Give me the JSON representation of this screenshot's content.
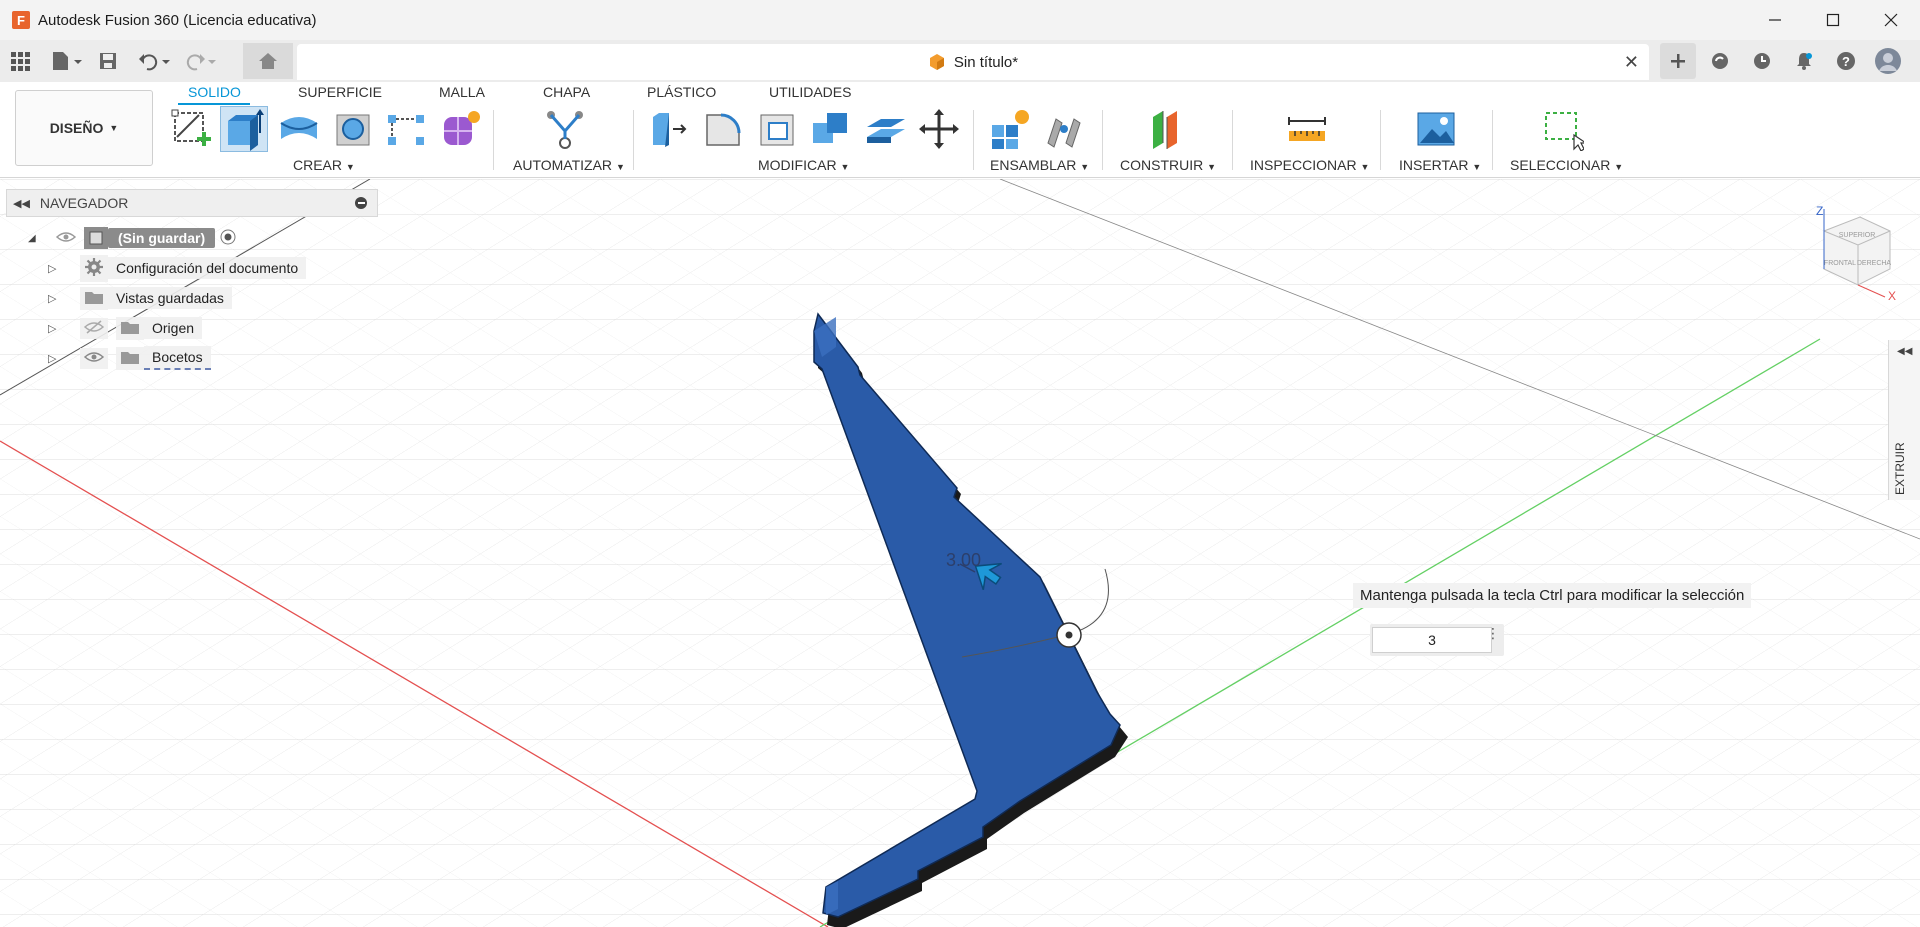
{
  "window": {
    "title": "Autodesk Fusion 360 (Licencia educativa)",
    "app_icon_letter": "F"
  },
  "document_tab": {
    "title": "Sin título*"
  },
  "ribbon": {
    "workspace_label": "DISEÑO",
    "tabs": [
      "SOLIDO",
      "SUPERFICIE",
      "MALLA",
      "CHAPA",
      "PLÁSTICO",
      "UTILIDADES"
    ],
    "active_tab": "SOLIDO",
    "groups": {
      "crear": "CREAR",
      "automatizar": "AUTOMATIZAR",
      "modificar": "MODIFICAR",
      "ensamblar": "ENSAMBLAR",
      "construir": "CONSTRUIR",
      "inspeccionar": "INSPECCIONAR",
      "insertar": "INSERTAR",
      "seleccionar": "SELECCIONAR"
    },
    "accent_color": "#0696d7"
  },
  "navigator": {
    "title": "NAVEGADOR",
    "root_label": "(Sin guardar)",
    "items": [
      {
        "label": "Configuración del documento",
        "icon": "gear-icon"
      },
      {
        "label": "Vistas guardadas",
        "icon": "folder-icon"
      },
      {
        "label": "Origen",
        "icon": "folder-icon",
        "visibility": "hidden"
      },
      {
        "label": "Bocetos",
        "icon": "folder-icon",
        "visibility": "visible"
      }
    ]
  },
  "viewport": {
    "dimension_label": "3.00",
    "hint": "Mantenga pulsada la tecla Ctrl para modificar la selección",
    "input_value": "3",
    "body_color": "#2a5ba8",
    "viewcube_axes": {
      "z": "Z",
      "x": "X"
    }
  },
  "side_panel": {
    "label": "EXTRUIR"
  }
}
